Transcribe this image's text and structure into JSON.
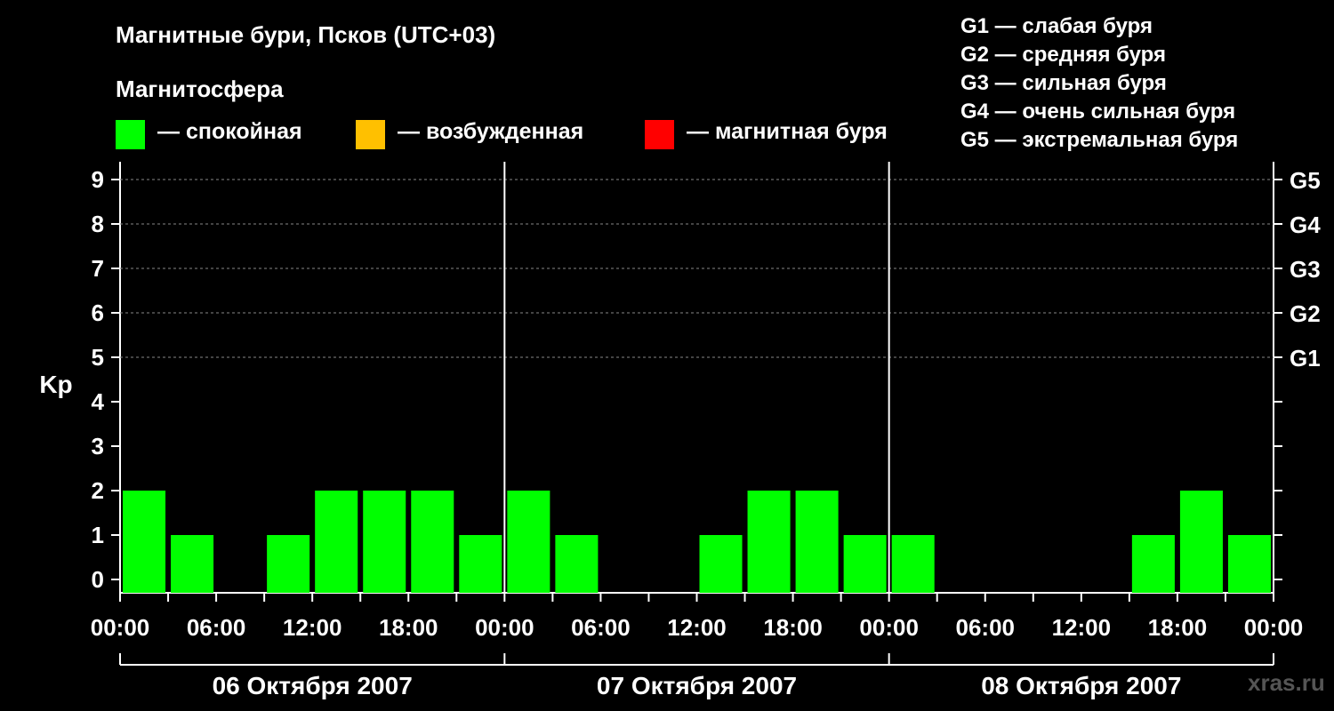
{
  "chart_data": {
    "type": "bar",
    "title": "Магнитные бури, Псков (UTC+03)",
    "subtitle": "Магнитосфера",
    "ylabel": "Kp",
    "ylim": [
      0,
      9
    ],
    "yticks": [
      "0",
      "1",
      "2",
      "3",
      "4",
      "5",
      "6",
      "7",
      "8",
      "9"
    ],
    "g_levels": [
      {
        "label": "G1",
        "kp": 5
      },
      {
        "label": "G2",
        "kp": 6
      },
      {
        "label": "G3",
        "kp": 7
      },
      {
        "label": "G4",
        "kp": 8
      },
      {
        "label": "G5",
        "kp": 9
      }
    ],
    "legend": [
      {
        "label": "— спокойная",
        "color": "#00ff00"
      },
      {
        "label": "— возбужденная",
        "color": "#ffc000"
      },
      {
        "label": "— магнитная буря",
        "color": "#ff0000"
      }
    ],
    "g_legend": [
      "G1 — слабая буря",
      "G2 — средняя буря",
      "G3 — сильная буря",
      "G4 — очень сильная буря",
      "G5 — экстремальная буря"
    ],
    "xticks": [
      "00:00",
      "06:00",
      "12:00",
      "18:00",
      "00:00",
      "06:00",
      "12:00",
      "18:00",
      "00:00",
      "06:00",
      "12:00",
      "18:00",
      "00:00"
    ],
    "days": [
      {
        "label": "06 Октября 2007",
        "kp": [
          2,
          1,
          0,
          1,
          2,
          2,
          2,
          1
        ]
      },
      {
        "label": "07 Октября 2007",
        "kp": [
          2,
          1,
          0,
          0,
          1,
          2,
          2,
          1
        ]
      },
      {
        "label": "08 Октября 2007",
        "kp": [
          1,
          0,
          0,
          0,
          0,
          1,
          2,
          1
        ]
      }
    ],
    "grid": "dashed at Kp 9, 8, 7, 6, 5"
  },
  "watermark": "xras.ru"
}
